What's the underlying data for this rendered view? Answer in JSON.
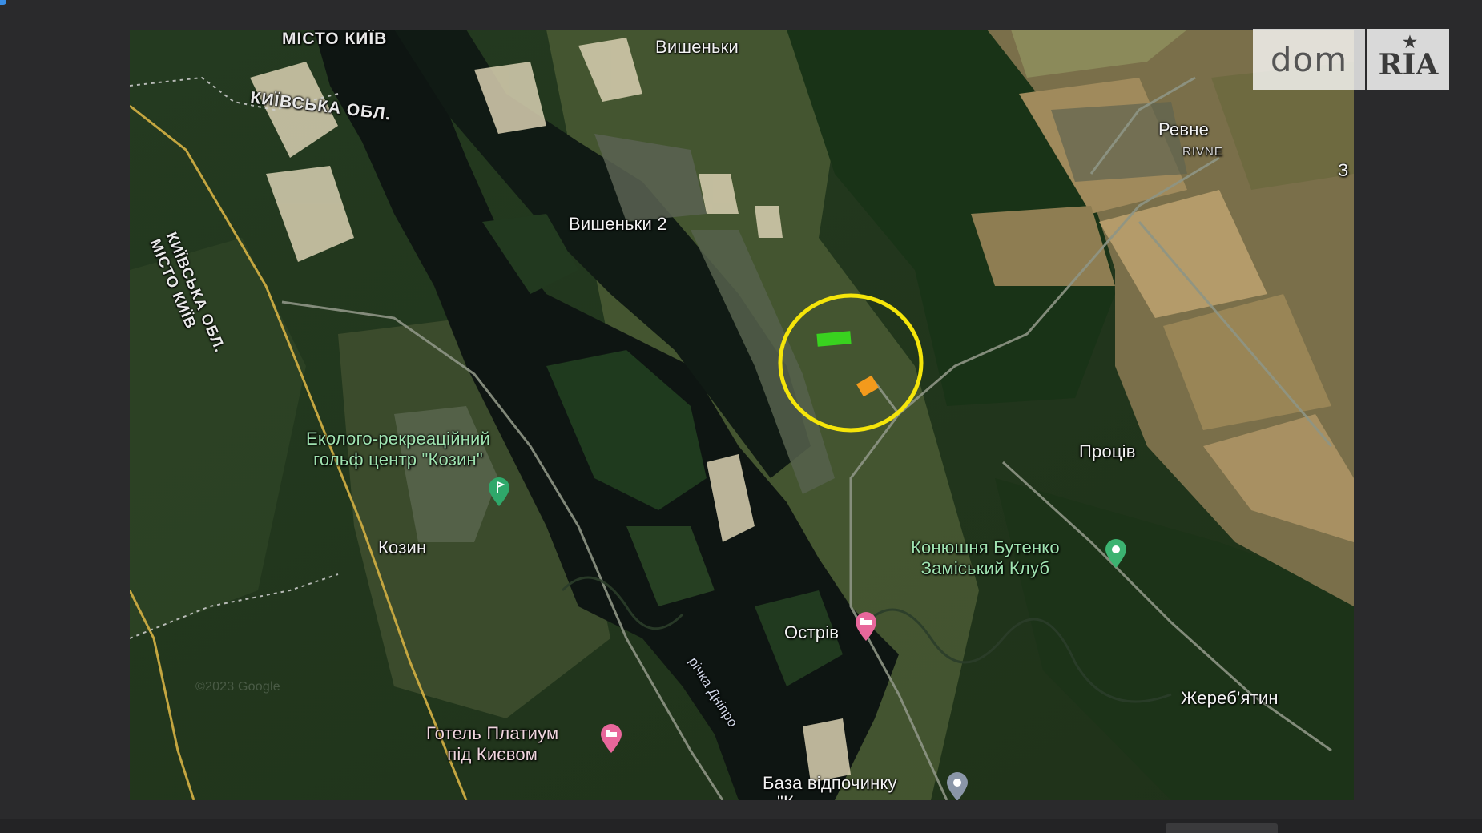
{
  "logo": {
    "dom_text": "dom",
    "ria_text": "RIA"
  },
  "map": {
    "labels": {
      "misto_kyiv_top": "МІСТО КИЇВ",
      "kyivska_obl": "КИЇВСЬКА ОБЛ.",
      "vyshenky": "Вишеньки",
      "vyshenky2": "Вишеньки 2",
      "rivne": "Ревне",
      "rivne_latin": "RIVNE",
      "edge_z": "З",
      "border_line1": "КИЇВСЬКА ОБЛ.",
      "border_line2": "МІСТО КИЇВ",
      "golf_line1": "Еколого-рекреаційний",
      "golf_line2": "гольф центр \"Козин\"",
      "kozyn": "Козин",
      "protsiv": "Проців",
      "stable_line1": "Конюшня Бутенко",
      "stable_line2": "Заміський Клуб",
      "ostriv": "Острів",
      "river": "річка Дніпро",
      "zherebiatyn": "Жереб'ятин",
      "hotel_line1": "Готель Платиум",
      "hotel_line2": "під Києвом",
      "base": "База відпочинку",
      "base_partial": "\"К",
      "watermark": "©2023 Google"
    },
    "icons": {
      "golf": "golf-pin-icon",
      "stable": "green-place-pin-icon",
      "ostriv": "hotel-pin-icon",
      "hotel": "hotel-pin-icon",
      "base": "grey-place-pin-icon"
    },
    "colors": {
      "highlight_circle": "#f5e50a",
      "plot_green": "#39d21f",
      "plot_orange": "#f39a1c",
      "golf_pin": "#2fa86a",
      "hotel_pin": "#e8679b",
      "stable_pin": "#3cb371"
    }
  }
}
